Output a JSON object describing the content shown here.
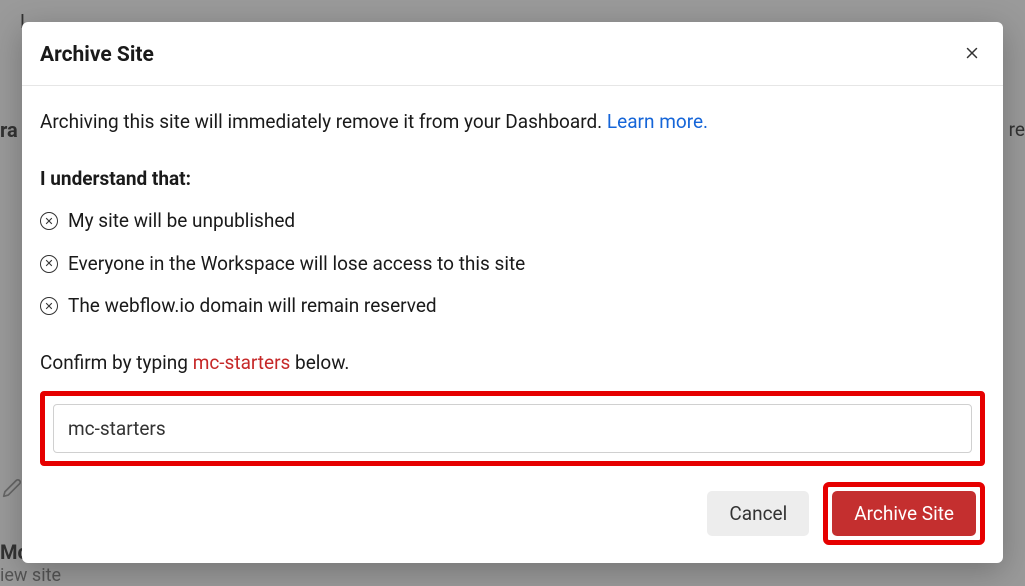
{
  "backdrop": {
    "t1": "L",
    "t2": "ra",
    "t3": "re",
    "t4": "Mc",
    "t5": "iew site"
  },
  "modal": {
    "title": "Archive Site",
    "intro_prefix": "Archiving this site will immediately remove it from your Dashboard. ",
    "learn_more": "Learn more.",
    "understand_heading": "I understand that:",
    "bullets": [
      "My site will be unpublished",
      "Everyone in the Workspace will lose access to this site",
      "The webflow.io domain will remain reserved"
    ],
    "confirm_prefix": "Confirm by typing ",
    "site_name": "mc-starters",
    "confirm_suffix": " below.",
    "input_value": "mc-starters",
    "cancel_label": "Cancel",
    "archive_label": "Archive Site"
  }
}
